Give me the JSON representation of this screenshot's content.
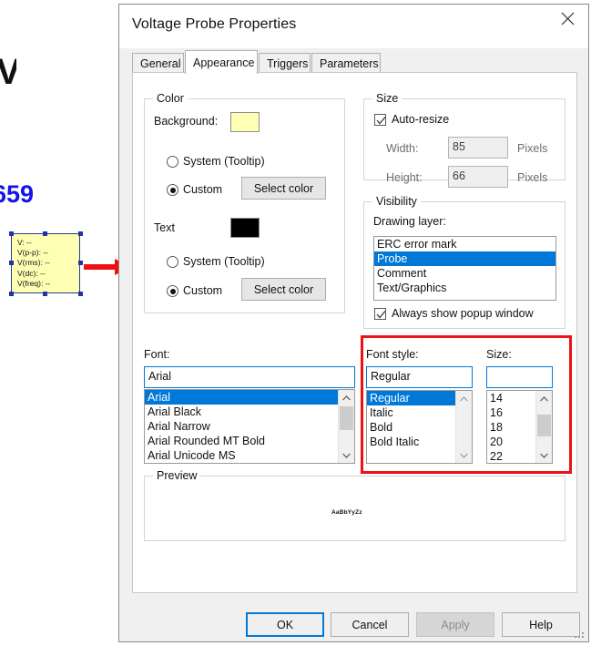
{
  "background": {
    "net_label": "659",
    "probe_widget": {
      "rows": [
        "V:  --",
        "V(p-p):  --",
        "V(rms):  --",
        "V(dc):  --",
        "V(freq):  --"
      ],
      "fill_color": "#FFFFB4",
      "border_color": "#2A3A8C"
    },
    "arrow_color": "#EE1111"
  },
  "dialog": {
    "title": "Voltage Probe Properties",
    "close_icon": "close-icon",
    "tabs": [
      {
        "label": "General",
        "active": false
      },
      {
        "label": "Appearance",
        "active": true
      },
      {
        "label": "Triggers",
        "active": false
      },
      {
        "label": "Parameters",
        "active": false
      }
    ],
    "color_group": {
      "legend": "Color",
      "background_label": "Background:",
      "background_swatch": "#FFFFB4",
      "background_system_radio": "System (Tooltip)",
      "background_custom_radio": "Custom",
      "background_custom_selected": true,
      "background_select_button": "Select color",
      "text_label": "Text",
      "text_swatch": "#000000",
      "text_system_radio": "System (Tooltip)",
      "text_custom_radio": "Custom",
      "text_custom_selected": true,
      "text_select_button": "Select color"
    },
    "size_group": {
      "legend": "Size",
      "auto_resize_label": "Auto-resize",
      "auto_resize_checked": true,
      "width_label": "Width:",
      "width_value": "85",
      "width_units": "Pixels",
      "height_label": "Height:",
      "height_value": "66",
      "height_units": "Pixels"
    },
    "visibility_group": {
      "legend": "Visibility",
      "drawing_layer_label": "Drawing layer:",
      "layers": [
        "ERC error mark",
        "Probe",
        "Comment",
        "Text/Graphics"
      ],
      "selected_layer": "Probe",
      "popup_label": "Always show popup window",
      "popup_checked": true
    },
    "font_section": {
      "font_label": "Font:",
      "font_value": "Arial",
      "font_options": [
        "Arial",
        "Arial Black",
        "Arial Narrow",
        "Arial Rounded MT Bold",
        "Arial Unicode MS"
      ],
      "font_selected": "Arial",
      "style_label": "Font style:",
      "style_value": "Regular",
      "style_options": [
        "Regular",
        "Italic",
        "Bold",
        "Bold Italic"
      ],
      "style_selected": "Regular",
      "size_label": "Size:",
      "size_value": "",
      "size_options": [
        "14",
        "16",
        "18",
        "20",
        "22"
      ],
      "size_selected": ""
    },
    "preview_group": {
      "legend": "Preview",
      "sample_text": "AaBbYyZz"
    },
    "buttons": {
      "ok": "OK",
      "cancel": "Cancel",
      "apply": "Apply",
      "apply_disabled": true,
      "help": "Help"
    },
    "accent_color": "#0078D7",
    "annotation_color": "#EE1111"
  }
}
